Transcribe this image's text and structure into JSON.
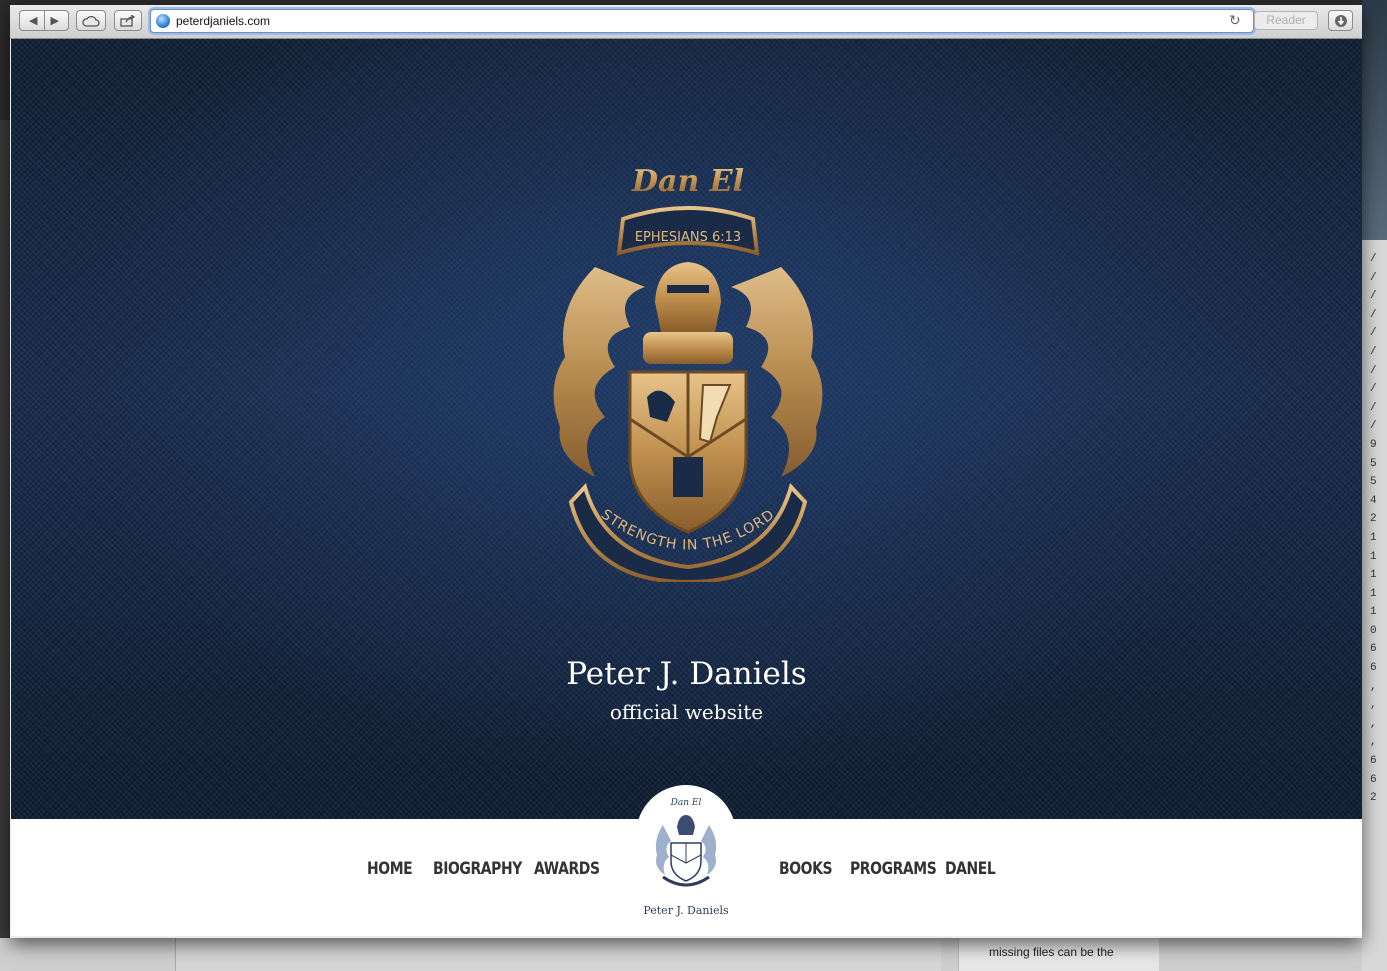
{
  "browser": {
    "url": "peterdjaniels.com",
    "reader_label": "Reader"
  },
  "hero": {
    "crest_top_text": "Dan El",
    "crest_banner_text": "EPHESIANS 6:13",
    "crest_motto": "STRENGTH IN THE LORD",
    "title": "Peter J. Daniels",
    "subtitle": "official website"
  },
  "nav": {
    "left_items": [
      "HOME",
      "BIOGRAPHY",
      "AWARDS"
    ],
    "right_items": [
      "BOOKS",
      "PROGRAMS",
      "DANEL"
    ],
    "badge_top_text": "Dan El",
    "badge_name": "Peter J. Daniels"
  },
  "background": {
    "caption": "missing files can be the"
  },
  "colors": {
    "hero_bg": "#14264a",
    "gold": "#c89a5a",
    "nav_text": "#333333"
  }
}
